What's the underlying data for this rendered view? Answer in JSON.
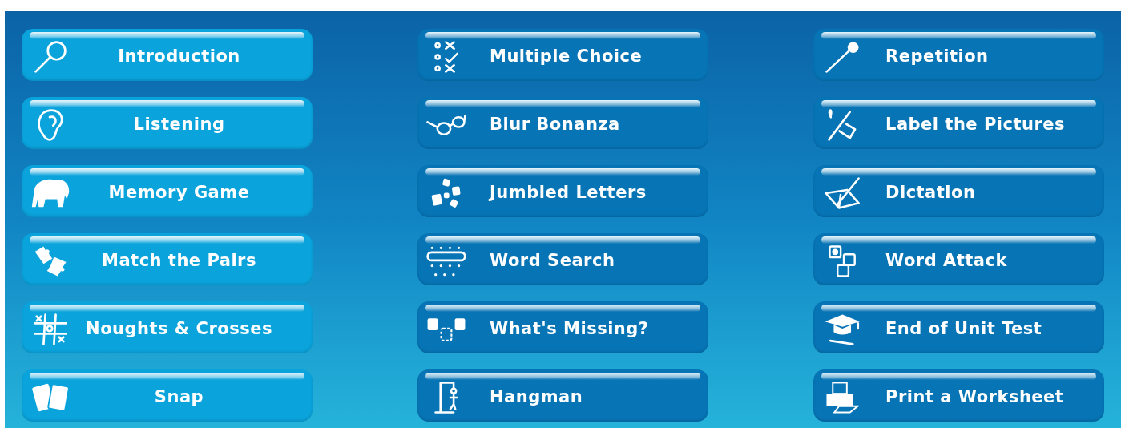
{
  "menu_columns": [
    {
      "kind": "light",
      "buttons": [
        {
          "label": "Introduction"
        },
        {
          "label": "Listening"
        },
        {
          "label": "Memory Game"
        },
        {
          "label": "Match the Pairs"
        },
        {
          "label": "Noughts & Crosses"
        },
        {
          "label": "Snap"
        }
      ]
    },
    {
      "kind": "dark",
      "buttons": [
        {
          "label": "Multiple Choice"
        },
        {
          "label": "Blur Bonanza"
        },
        {
          "label": "Jumbled Letters"
        },
        {
          "label": "Word Search"
        },
        {
          "label": "What's Missing?"
        },
        {
          "label": "Hangman"
        }
      ]
    },
    {
      "kind": "dark",
      "buttons": [
        {
          "label": "Repetition"
        },
        {
          "label": "Label the Pictures"
        },
        {
          "label": "Dictation"
        },
        {
          "label": "Word Attack"
        },
        {
          "label": "End of Unit Test"
        },
        {
          "label": "Print a Worksheet"
        }
      ]
    }
  ]
}
